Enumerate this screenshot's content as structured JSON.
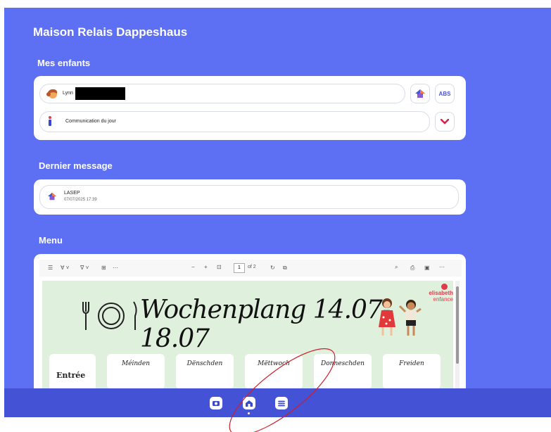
{
  "app": {
    "title": "Maison Relais Dappeshaus"
  },
  "children": {
    "heading": "Mes enfants",
    "child_name": "Lynn",
    "abs_label": "ABS",
    "communication_label": "Communication du jour"
  },
  "last_message": {
    "heading": "Dernier message",
    "sender": "LASEP",
    "datetime": "07/07/2025 17:39"
  },
  "menu": {
    "heading": "Menu",
    "pdf_toolbar": {
      "page": "1",
      "of_pages": "of 2"
    },
    "pdf": {
      "title": "Wochenplang 14.07- 18.07",
      "logo_line1": "elisabeth",
      "logo_line2": "enfance",
      "row_label": "Entrée",
      "days": [
        "Méinden",
        "Dënschden",
        "Mëttwoch",
        "Donneschden",
        "Freiden"
      ]
    }
  },
  "nav": {
    "items": [
      "camera-icon",
      "home-icon",
      "menu-list-icon"
    ],
    "active": "home-icon"
  },
  "colors": {
    "background": "#5d6ff2",
    "bottom_bar": "#4452d6",
    "accent": "#4a55d9",
    "annotation": "#cc1f2a"
  }
}
